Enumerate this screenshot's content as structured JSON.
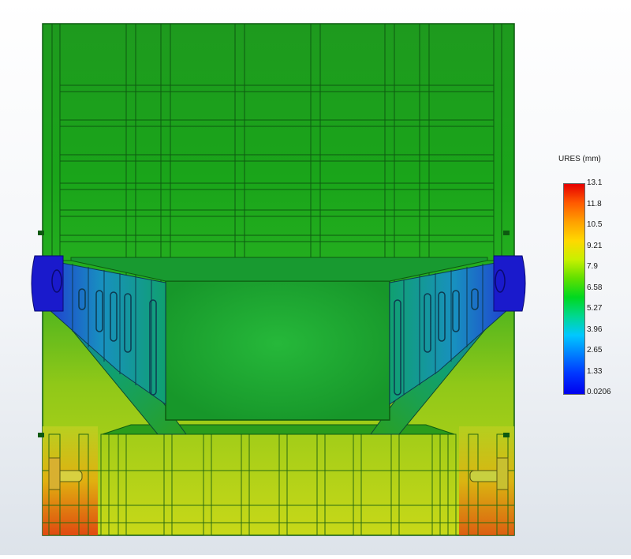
{
  "legend": {
    "title": "URES (mm)",
    "ticks": [
      "13.1",
      "11.8",
      "10.5",
      "9.21",
      "7.9",
      "6.58",
      "5.27",
      "3.96",
      "2.65",
      "1.33",
      "0.0206"
    ],
    "colors": [
      "#e60000",
      "#ff5a00",
      "#ffa000",
      "#ffd800",
      "#c8f000",
      "#60e000",
      "#00d820",
      "#00d890",
      "#00c8ff",
      "#0080ff",
      "#0038ff",
      "#0000ee"
    ]
  },
  "model_colors": {
    "body": "#1fa01f",
    "body_dark": "#138a14",
    "lines": "#0d5a10",
    "support_blue": "#1a1acc",
    "base_yellow": "#b8e020",
    "base_red": "#e04010"
  }
}
